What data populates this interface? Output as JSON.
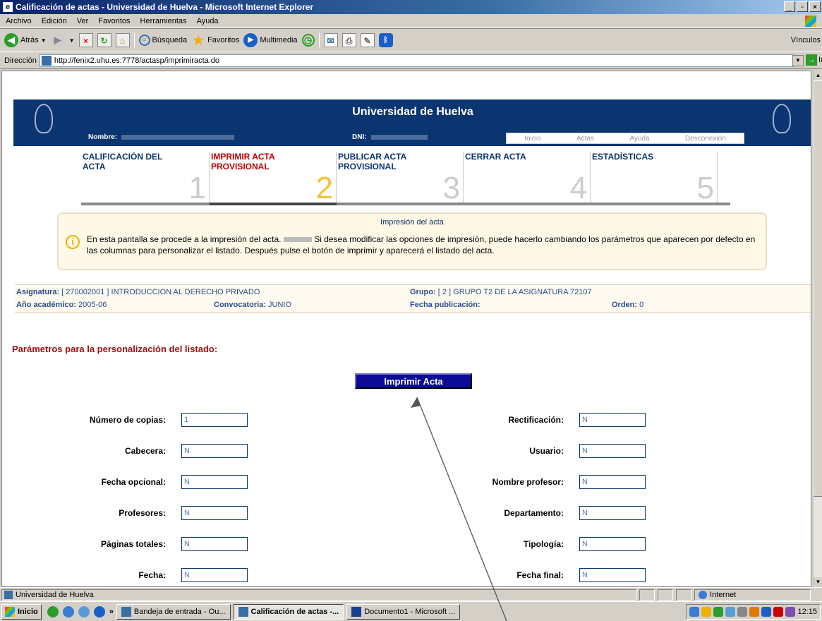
{
  "window": {
    "title": "Calificación de actas - Universidad de Huelva - Microsoft Internet Explorer"
  },
  "menu": [
    "Archivo",
    "Edición",
    "Ver",
    "Favoritos",
    "Herramientas",
    "Ayuda"
  ],
  "toolbar": {
    "back": "Atrás",
    "search": "Búsqueda",
    "favorites": "Favoritos",
    "multimedia": "Multimedia",
    "links": "Vínculos"
  },
  "address": {
    "label": "Dirección",
    "url": "http://fenix2.uhu.es:7778/actasp/imprimiracta.do",
    "go": "Ir"
  },
  "header": {
    "university": "Universidad de Huelva",
    "nombre_label": "Nombre:",
    "dni_label": "DNI:",
    "nav": [
      "Inicio",
      "Actas",
      "Ayuda",
      "Desconexión"
    ]
  },
  "steps": [
    {
      "label": "CALIFICACIÓN DEL\nACTA",
      "num": "1"
    },
    {
      "label": "IMPRIMIR ACTA\nPROVISIONAL",
      "num": "2"
    },
    {
      "label": "PUBLICAR ACTA\nPROVISIONAL",
      "num": "3"
    },
    {
      "label": "CERRAR ACTA",
      "num": "4"
    },
    {
      "label": "ESTADÍSTICAS",
      "num": "5"
    }
  ],
  "notice": {
    "title": "Impresión del acta",
    "text_1": "En esta pantalla se procede a la impresión del acta.",
    "text_2": "Si desea modificar las opciones de impresión, puede hacerlo cambiando los parámetros que aparecen por defecto en las columnas para personalizar el listado. Después pulse el botón de imprimir y aparecerá el listado del acta."
  },
  "asignatura": {
    "asig_label": "Asignatura:",
    "asig_value": "[ 270002001 ] INTRODUCCION AL DERECHO PRIVADO",
    "grupo_label": "Grupo:",
    "grupo_value": "[ 2 ] GRUPO T2 DE LA ASIGNATURA 72107",
    "anio_label": "Año académico:",
    "anio_value": "2005-06",
    "conv_label": "Convocatoria:",
    "conv_value": "JUNIO",
    "fecha_label": "Fecha publicación:",
    "orden_label": "Orden:",
    "orden_value": "0"
  },
  "params_title": "Parámetros para la personalización del listado:",
  "print_button": "Imprimir Acta",
  "form_left": [
    {
      "label": "Número de copias:",
      "value": "1"
    },
    {
      "label": "Cabecera:",
      "value": "N"
    },
    {
      "label": "Fecha opcional:",
      "value": "N"
    },
    {
      "label": "Profesores:",
      "value": "N"
    },
    {
      "label": "Páginas totales:",
      "value": "N"
    },
    {
      "label": "Fecha:",
      "value": "N"
    }
  ],
  "form_right": [
    {
      "label": "Rectificación:",
      "value": "N"
    },
    {
      "label": "Usuario:",
      "value": "N"
    },
    {
      "label": "Nombre profesor:",
      "value": "N"
    },
    {
      "label": "Departamento:",
      "value": "N"
    },
    {
      "label": "Tipología:",
      "value": "N"
    },
    {
      "label": "Fecha final:",
      "value": "N"
    }
  ],
  "status": {
    "text": "Universidad de Huelva",
    "zone": "Internet"
  },
  "taskbar": {
    "start": "Inicio",
    "tasks": [
      "Bandeja de entrada - Ou...",
      "Calificación de actas -...",
      "Documento1 - Microsoft ..."
    ],
    "clock": "12:15"
  }
}
